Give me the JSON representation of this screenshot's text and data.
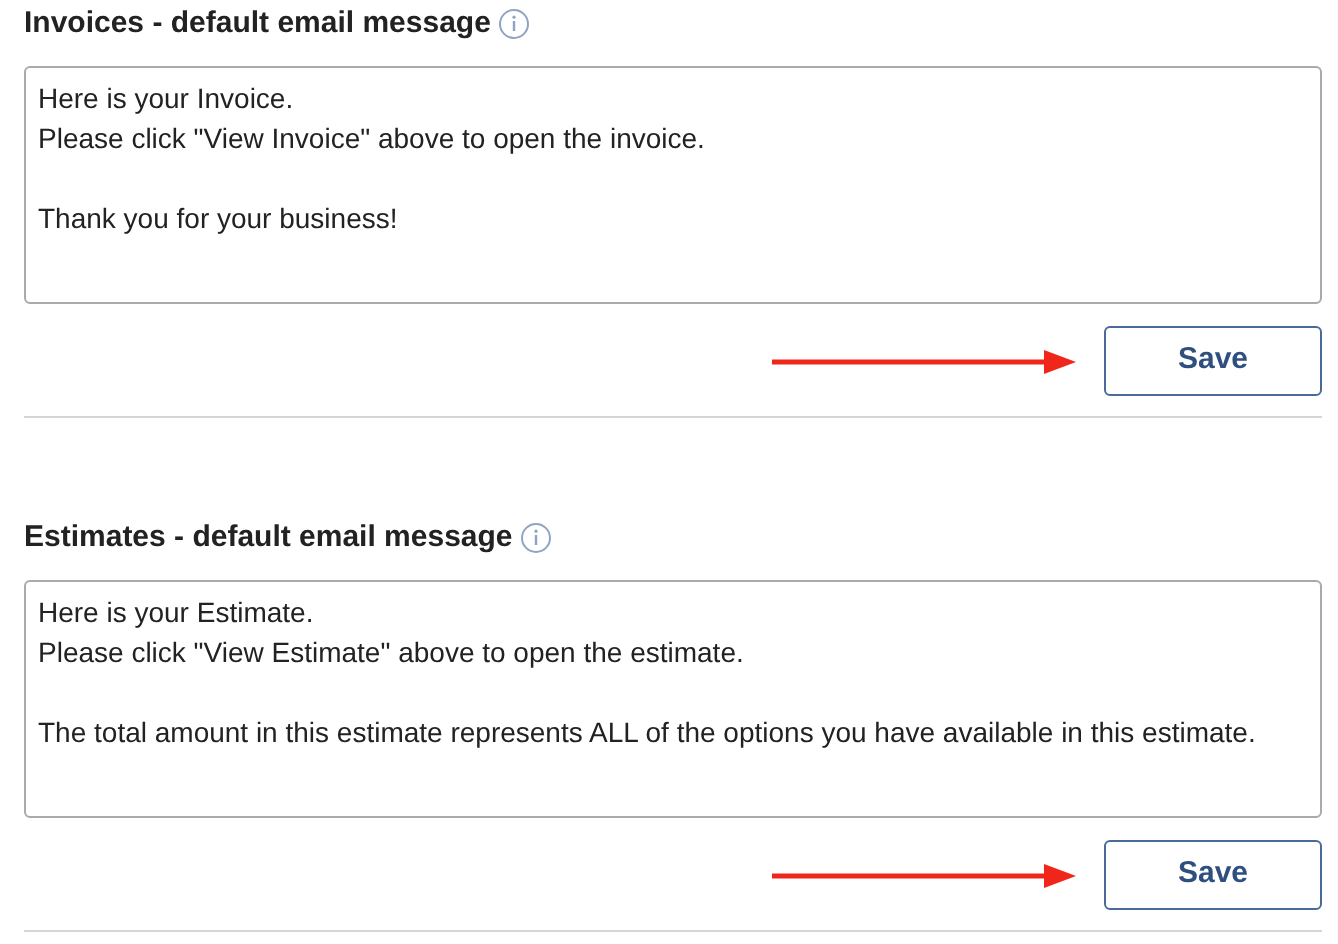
{
  "sections": [
    {
      "title": "Invoices - default email message",
      "message": "Here is your Invoice.\nPlease click \"View Invoice\" above to open the invoice.\n\nThank you for your business!",
      "save_label": "Save"
    },
    {
      "title": "Estimates - default email message",
      "message": "Here is your Estimate.\nPlease click \"View Estimate\" above to open the estimate.\n\nThe total amount in this estimate represents ALL of the options you have available in this estimate.",
      "save_label": "Save"
    }
  ]
}
